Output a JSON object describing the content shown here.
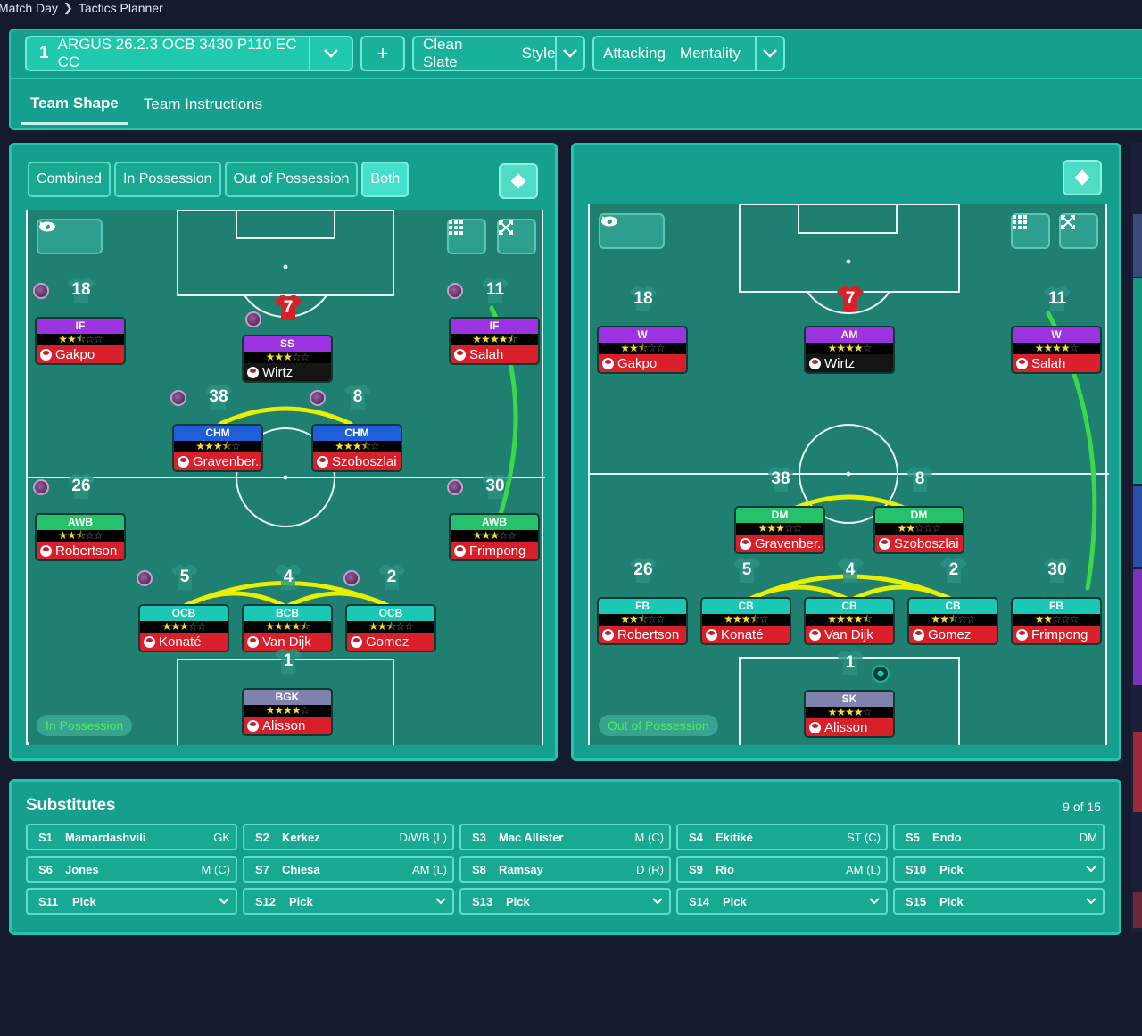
{
  "breadcrumb": {
    "parent": "Match Day",
    "current": "Tactics Planner"
  },
  "tactic": {
    "slot": "1",
    "name": "ARGUS 26.2.3 OCB 3430 P110 EC CC",
    "add_label": "+"
  },
  "style": {
    "value": "Clean Slate",
    "label": "Style"
  },
  "mentality": {
    "value": "Attacking",
    "label": "Mentality"
  },
  "tabs": [
    {
      "label": "Team Shape"
    },
    {
      "label": "Team Instructions"
    }
  ],
  "phase_tabs": [
    {
      "label": "Combined"
    },
    {
      "label": "In Possession"
    },
    {
      "label": "Out of Possession"
    },
    {
      "label": "Both"
    }
  ],
  "in_possession": {
    "badge": "In Possession",
    "players": [
      {
        "num": "18",
        "role": "IF",
        "stars": 2.5,
        "name": "Gakpo",
        "role_color": "#9b34e0"
      },
      {
        "num": "7",
        "role": "SS",
        "stars": 3,
        "name": "Wirtz",
        "role_color": "#9b34e0"
      },
      {
        "num": "11",
        "role": "IF",
        "stars": 4.5,
        "name": "Salah",
        "role_color": "#9b34e0"
      },
      {
        "num": "38",
        "role": "CHM",
        "stars": 3.5,
        "name": "Gravenber...",
        "role_color": "#1f5ed6"
      },
      {
        "num": "8",
        "role": "CHM",
        "stars": 3.5,
        "name": "Szoboszlai",
        "role_color": "#1f5ed6"
      },
      {
        "num": "26",
        "role": "AWB",
        "stars": 2.5,
        "name": "Robertson",
        "role_color": "#26c16a"
      },
      {
        "num": "30",
        "role": "AWB",
        "stars": 3,
        "name": "Frimpong",
        "role_color": "#26c16a"
      },
      {
        "num": "5",
        "role": "OCB",
        "stars": 3,
        "name": "Konaté",
        "role_color": "#19c9b6"
      },
      {
        "num": "4",
        "role": "BCB",
        "stars": 4.5,
        "name": "Van Dijk",
        "role_color": "#19c9b6"
      },
      {
        "num": "2",
        "role": "OCB",
        "stars": 2.5,
        "name": "Gomez",
        "role_color": "#19c9b6"
      },
      {
        "num": "1",
        "role": "BGK",
        "stars": 4,
        "name": "Alisson",
        "role_color": "#7f82ac"
      }
    ]
  },
  "out_of_possession": {
    "badge": "Out of Possession",
    "players": [
      {
        "num": "18",
        "role": "W",
        "stars": 2.5,
        "name": "Gakpo",
        "role_color": "#9b34e0"
      },
      {
        "num": "7",
        "role": "AM",
        "stars": 4,
        "name": "Wirtz",
        "role_color": "#9b34e0"
      },
      {
        "num": "11",
        "role": "W",
        "stars": 4,
        "name": "Salah",
        "role_color": "#9b34e0"
      },
      {
        "num": "38",
        "role": "DM",
        "stars": 3,
        "name": "Gravenber...",
        "role_color": "#26c16a"
      },
      {
        "num": "8",
        "role": "DM",
        "stars": 2,
        "name": "Szoboszlai",
        "role_color": "#26c16a"
      },
      {
        "num": "26",
        "role": "FB",
        "stars": 2.5,
        "name": "Robertson",
        "role_color": "#19c9b6"
      },
      {
        "num": "5",
        "role": "CB",
        "stars": 3.5,
        "name": "Konaté",
        "role_color": "#19c9b6"
      },
      {
        "num": "4",
        "role": "CB",
        "stars": 4.5,
        "name": "Van Dijk",
        "role_color": "#19c9b6"
      },
      {
        "num": "2",
        "role": "CB",
        "stars": 2.5,
        "name": "Gomez",
        "role_color": "#19c9b6"
      },
      {
        "num": "30",
        "role": "FB",
        "stars": 2,
        "name": "Frimpong",
        "role_color": "#19c9b6"
      },
      {
        "num": "1",
        "role": "SK",
        "stars": 4,
        "name": "Alisson",
        "role_color": "#7f82ac"
      }
    ]
  },
  "substitutes": {
    "title": "Substitutes",
    "count": "9 of 15",
    "items": [
      {
        "code": "S1",
        "name": "Mamardashvili",
        "pos": "GK"
      },
      {
        "code": "S2",
        "name": "Kerkez",
        "pos": "D/WB (L)"
      },
      {
        "code": "S3",
        "name": "Mac Allister",
        "pos": "M (C)"
      },
      {
        "code": "S4",
        "name": "Ekitiké",
        "pos": "ST (C)"
      },
      {
        "code": "S5",
        "name": "Endo",
        "pos": "DM"
      },
      {
        "code": "S6",
        "name": "Jones",
        "pos": "M (C)"
      },
      {
        "code": "S7",
        "name": "Chiesa",
        "pos": "AM (L)"
      },
      {
        "code": "S8",
        "name": "Ramsay",
        "pos": "D (R)"
      },
      {
        "code": "S9",
        "name": "Rio",
        "pos": "AM (L)"
      },
      {
        "code": "S10",
        "name": "Pick",
        "pos": ""
      },
      {
        "code": "S11",
        "name": "Pick",
        "pos": ""
      },
      {
        "code": "S12",
        "name": "Pick",
        "pos": ""
      },
      {
        "code": "S13",
        "name": "Pick",
        "pos": ""
      },
      {
        "code": "S14",
        "name": "Pick",
        "pos": ""
      },
      {
        "code": "S15",
        "name": "Pick",
        "pos": ""
      }
    ]
  },
  "colors": {
    "panel": "#14a08c",
    "pitch": "#1f7f70",
    "accent": "#45e0cb",
    "star": "#f6dd2b",
    "link_yellow": "#e8f000",
    "link_green": "#3bd84a"
  }
}
